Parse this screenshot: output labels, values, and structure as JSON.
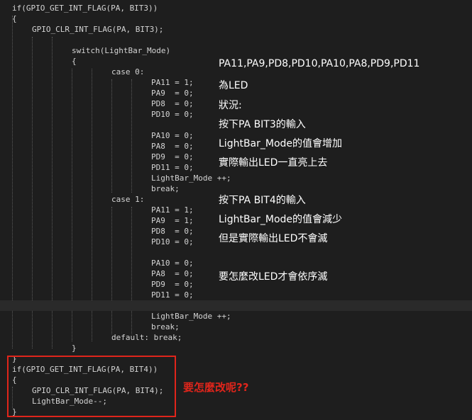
{
  "code": {
    "lines": [
      "if(GPIO_GET_INT_FLAG(PA, BIT3))",
      "{",
      "GPIO_CLR_INT_FLAG(PA, BIT3);",
      "",
      "switch(LightBar_Mode)",
      "{",
      "case 0:",
      "PA11 = 1;",
      "PA9  = 0;",
      "PD8  = 0;",
      "PD10 = 0;",
      "",
      "PA10 = 0;",
      "PA8  = 0;",
      "PD9  = 0;",
      "PD11 = 0;",
      "LightBar_Mode ++;",
      "break;",
      "case 1:",
      "PA11 = 1;",
      "PA9  = 1;",
      "PD8  = 0;",
      "PD10 = 0;",
      "",
      "PA10 = 0;",
      "PA8  = 0;",
      "PD9  = 0;",
      "PD11 = 0;",
      "",
      "LightBar_Mode ++;",
      "break;",
      "default: break;",
      "}",
      "}",
      "if(GPIO_GET_INT_FLAG(PA, BIT4))",
      "{",
      "GPIO_CLR_INT_FLAG(PA, BIT4);",
      "LightBar_Mode--;",
      "}"
    ]
  },
  "annotations": {
    "leds": "PA11,PA9,PD8,PD10,PA10,PA8,PD9,PD11",
    "is_led": "為LED",
    "status_label": "狀況:",
    "bit3_press": "按下PA BIT3的輸入",
    "mode_increase": "LightBar_Mode的值會增加",
    "leds_light_up": "實際輸出LED一直亮上去",
    "bit4_press": "按下PA BIT4的輸入",
    "mode_decrease": "LightBar_Mode的值會減少",
    "leds_not_off": "但是實際輸出LED不會滅",
    "how_to_fix": "要怎麼改LED才會依序滅"
  },
  "question": "要怎麼改呢??",
  "colors": {
    "background": "#1e1e1e",
    "code_text": "#d4d4d4",
    "annotation_text": "#ffffff",
    "highlight_red": "#e0251b"
  }
}
